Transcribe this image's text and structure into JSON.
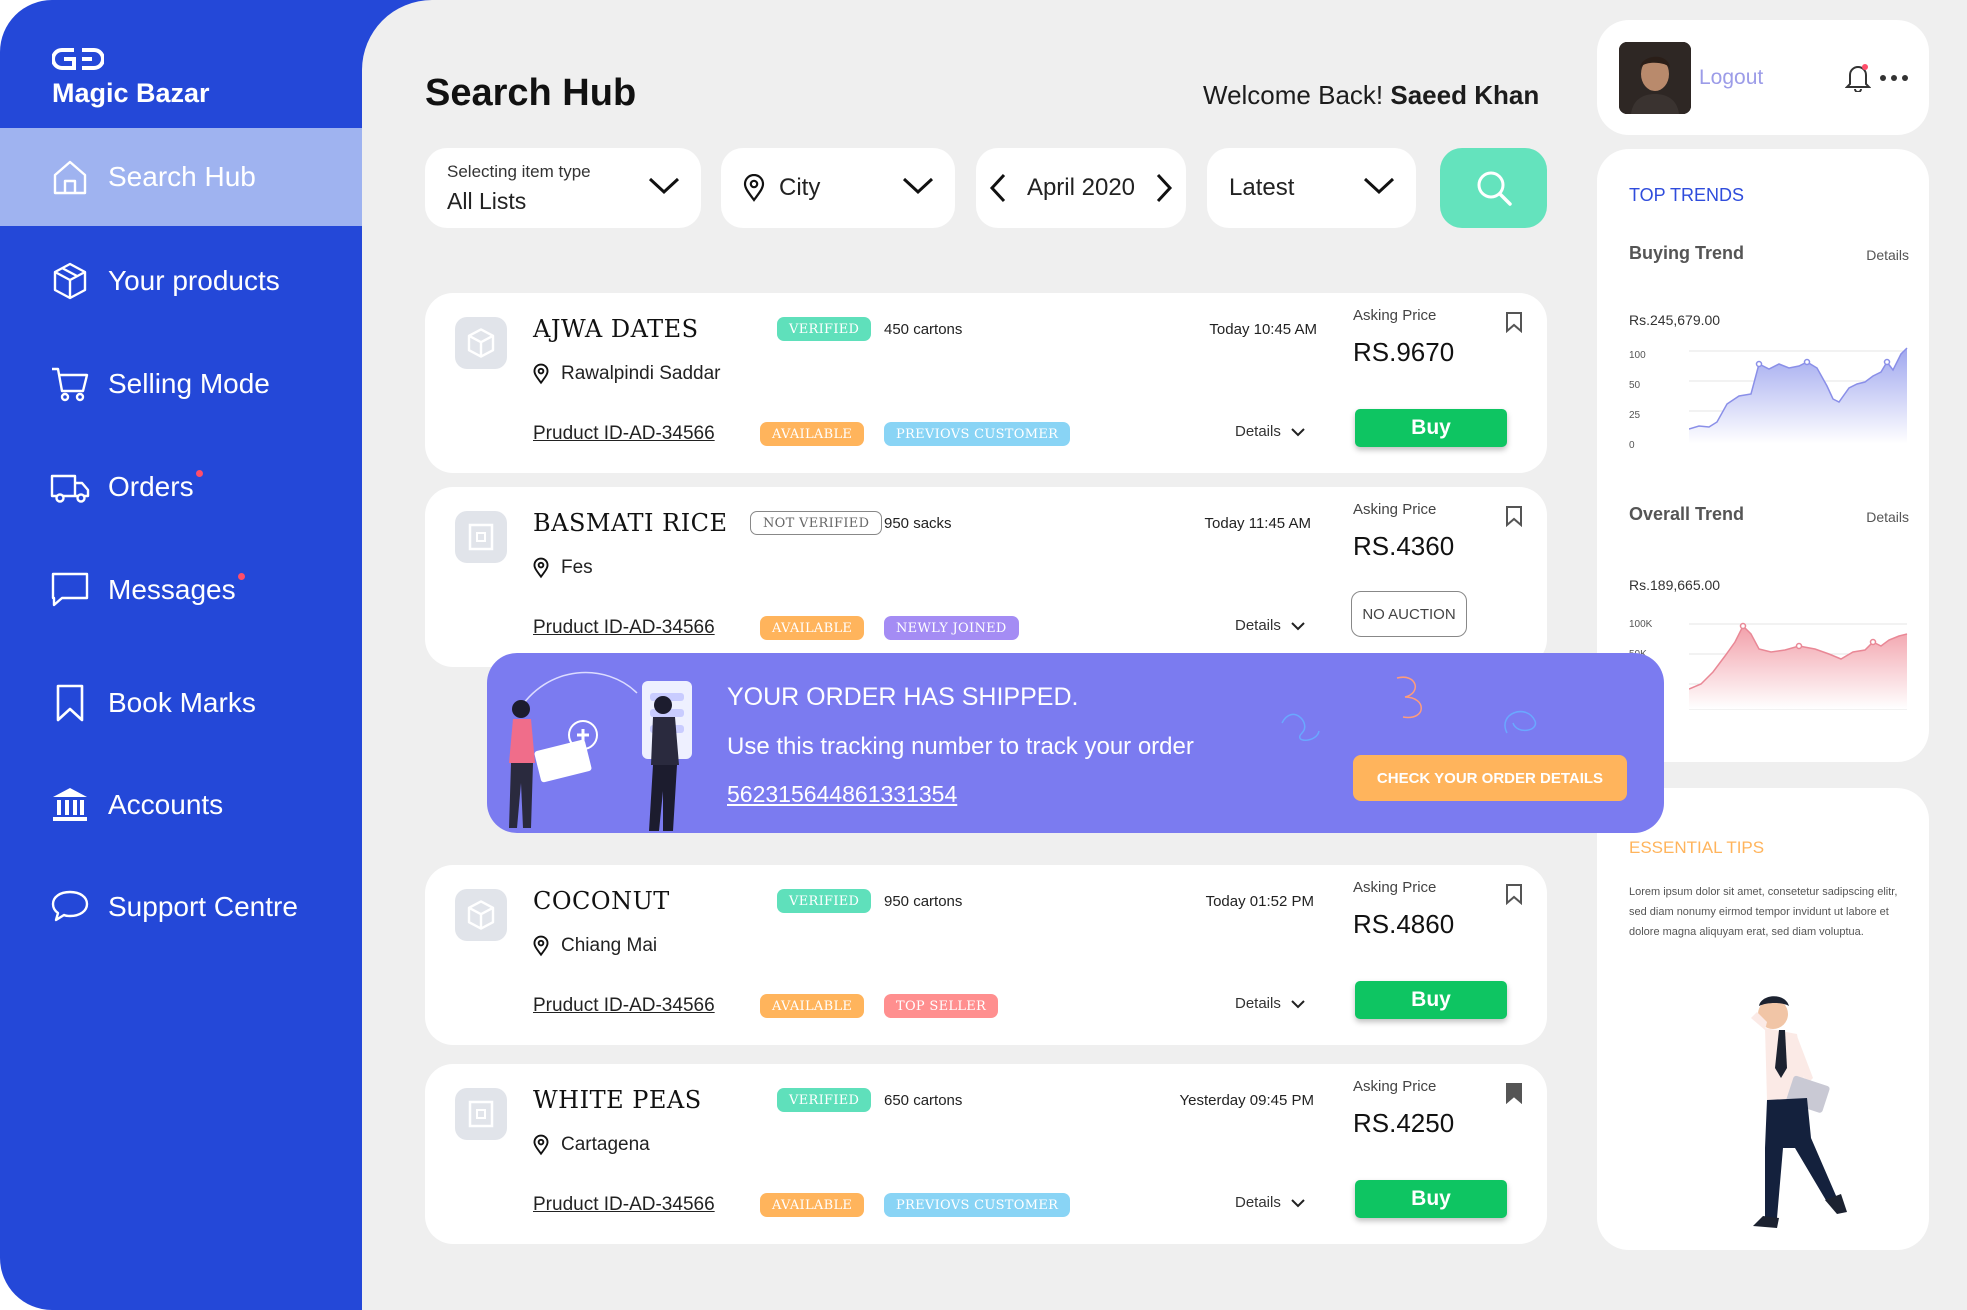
{
  "brand": {
    "name": "Magic Bazar"
  },
  "sidebar": {
    "items": [
      {
        "label": "Search Hub"
      },
      {
        "label": "Your products"
      },
      {
        "label": "Selling Mode"
      },
      {
        "label": "Orders"
      },
      {
        "label": "Messages"
      },
      {
        "label": "Book Marks"
      },
      {
        "label": "Accounts"
      },
      {
        "label": "Support Centre"
      }
    ]
  },
  "header": {
    "title": "Search Hub",
    "welcome_prefix": "Welcome Back!",
    "user_name": "Saeed Khan"
  },
  "filters": {
    "item_type_label": "Selecting item type",
    "item_type_value": "All Lists",
    "city": "City",
    "month": "April 2020",
    "sort": "Latest"
  },
  "listings": [
    {
      "name": "AJWA DATES",
      "status": "VERIFIED",
      "quantity": "450 cartons",
      "time": "Today 10:45 AM",
      "location": "Rawalpindi Saddar",
      "product_id": "Pruduct ID-AD-34566",
      "availability": "AVAILABLE",
      "tag": "PREVIOVS CUSTOMER",
      "details": "Details",
      "ask_label": "Asking Price",
      "price": "RS.9670",
      "action": "Buy"
    },
    {
      "name": "BASMATI RICE",
      "status": "NOT VERIFIED",
      "quantity": "950 sacks",
      "time": "Today 11:45 AM",
      "location": "Fes",
      "product_id": "Pruduct ID-AD-34566",
      "availability": "AVAILABLE",
      "tag": "NEWLY JOINED",
      "details": "Details",
      "ask_label": "Asking Price",
      "price": "RS.4360",
      "action": "NO AUCTION"
    },
    {
      "name": "COCONUT",
      "status": "VERIFIED",
      "quantity": "950 cartons",
      "time": "Today 01:52 PM",
      "location": "Chiang Mai",
      "product_id": "Pruduct ID-AD-34566",
      "availability": "AVAILABLE",
      "tag": "TOP SELLER",
      "details": "Details",
      "ask_label": "Asking Price",
      "price": "RS.4860",
      "action": "Buy"
    },
    {
      "name": "WHITE PEAS",
      "status": "VERIFIED",
      "quantity": "650 cartons",
      "time": "Yesterday 09:45 PM",
      "location": "Cartagena",
      "product_id": "Pruduct ID-AD-34566",
      "availability": "AVAILABLE",
      "tag": "PREVIOVS CUSTOMER",
      "details": "Details",
      "ask_label": "Asking Price",
      "price": "RS.4250",
      "action": "Buy"
    }
  ],
  "notification": {
    "title": "YOUR ORDER HAS SHIPPED.",
    "message": "Use this tracking number to track your order",
    "tracking": "562315644861331354",
    "cta": "CHECK YOUR ORDER DETAILS"
  },
  "profile": {
    "logout": "Logout"
  },
  "trends": {
    "title": "TOP TRENDS",
    "buying": {
      "label": "Buying Trend",
      "details": "Details",
      "amount": "Rs.245,679.00",
      "ticks": [
        "100",
        "50",
        "25",
        "0"
      ]
    },
    "overall": {
      "label": "Overall Trend",
      "details": "Details",
      "amount": "Rs.189,665.00",
      "ticks": [
        "100K",
        "50K"
      ]
    }
  },
  "tips": {
    "title": "ESSENTIAL TIPS",
    "text": "Lorem ipsum dolor sit amet, consetetur sadipscing elitr, sed diam nonumy eirmod tempor invidunt ut labore et dolore magna aliquyam erat, sed diam voluptua."
  },
  "colors": {
    "sidebar": "#2448d8",
    "active_nav": "#9fb3f0",
    "accent_green": "#0ec562",
    "search_button": "#64e3bd",
    "banner": "#7b7bf0",
    "orange": "#ffb45c"
  }
}
